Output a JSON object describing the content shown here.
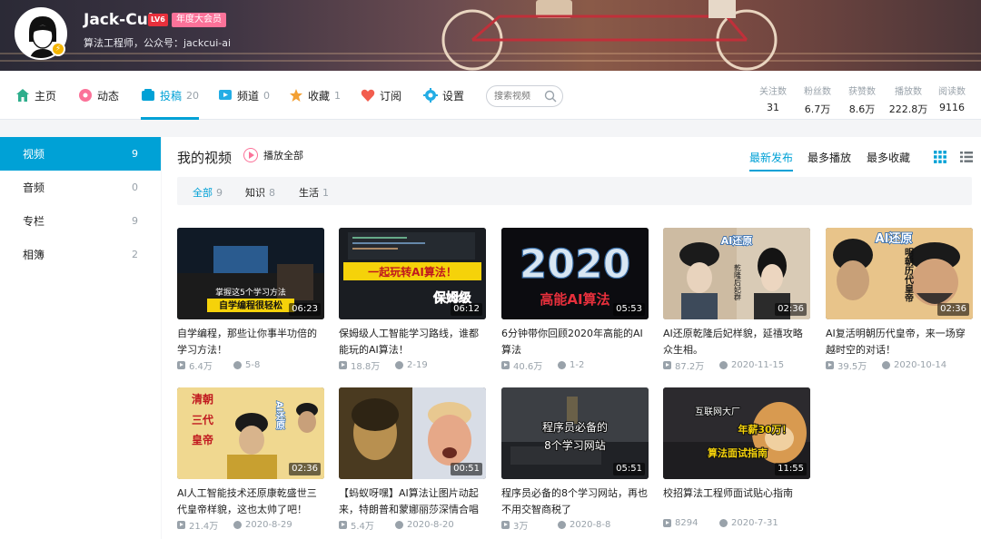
{
  "user": {
    "name": "Jack-Cui",
    "level": "LV6",
    "vip_label": "年度大会员",
    "sign": "算法工程师，公众号：jackcui-ai"
  },
  "nav": {
    "items": [
      {
        "label": "主页",
        "count": "",
        "icon": "home-icon",
        "color": "#23ade5"
      },
      {
        "label": "动态",
        "count": "",
        "icon": "dynamic-icon",
        "color": "#fb7299"
      },
      {
        "label": "投稿",
        "count": "20",
        "icon": "upload-icon",
        "color": "#00a1d6"
      },
      {
        "label": "频道",
        "count": "0",
        "icon": "channel-icon",
        "color": "#23ade5"
      },
      {
        "label": "收藏",
        "count": "1",
        "icon": "star-icon",
        "color": "#f3a034"
      },
      {
        "label": "订阅",
        "count": "",
        "icon": "heart-icon",
        "color": "#f25d4e"
      },
      {
        "label": "设置",
        "count": "",
        "icon": "gear-icon",
        "color": "#23ade5"
      }
    ],
    "search_placeholder": "搜索视频"
  },
  "stats": [
    {
      "label": "关注数",
      "value": "31"
    },
    {
      "label": "粉丝数",
      "value": "6.7万"
    },
    {
      "label": "获赞数",
      "value": "8.6万"
    },
    {
      "label": "播放数",
      "value": "222.8万"
    },
    {
      "label": "阅读数",
      "value": "9116"
    }
  ],
  "sidebar": {
    "items": [
      {
        "label": "视频",
        "count": "9"
      },
      {
        "label": "音频",
        "count": "0"
      },
      {
        "label": "专栏",
        "count": "9"
      },
      {
        "label": "相簿",
        "count": "2"
      }
    ]
  },
  "main": {
    "title": "我的视频",
    "play_all": "播放全部",
    "sort": [
      "最新发布",
      "最多播放",
      "最多收藏"
    ],
    "filters": [
      {
        "label": "全部",
        "count": "9"
      },
      {
        "label": "知识",
        "count": "8"
      },
      {
        "label": "生活",
        "count": "1"
      }
    ]
  },
  "videos": [
    {
      "title": "自学编程，那些让你事半功倍的学习方法！",
      "duration": "06:23",
      "plays": "6.4万",
      "date": "5-8",
      "thumb_text": [
        "掌握这5个学习方法",
        "自学编程很轻松"
      ]
    },
    {
      "title": "保姆级人工智能学习路线，谁都能玩的AI算法！",
      "duration": "06:12",
      "plays": "18.8万",
      "date": "2-19",
      "thumb_text": [
        "一起玩转AI算法！",
        "保姆级"
      ]
    },
    {
      "title": "6分钟带你回顾2020年高能的AI算法",
      "duration": "05:53",
      "plays": "40.6万",
      "date": "1-2",
      "thumb_text": [
        "2020",
        "高能AI算法"
      ]
    },
    {
      "title": "AI还原乾隆后妃样貌，延禧攻略众生相。",
      "duration": "02:36",
      "plays": "87.2万",
      "date": "2020-11-15",
      "thumb_text": [
        "AI还原",
        "乾隆后妃群"
      ]
    },
    {
      "title": "AI复活明朝历代皇帝，来一场穿越时空的对话！",
      "duration": "02:36",
      "plays": "39.5万",
      "date": "2020-10-14",
      "thumb_text": [
        "AI还原",
        "明朝历代皇帝"
      ]
    },
    {
      "title": "AI人工智能技术还原康乾盛世三代皇帝样貌，这也太帅了吧！",
      "duration": "02:36",
      "plays": "21.4万",
      "date": "2020-8-29",
      "thumb_text": [
        "清朝",
        "三代",
        "皇帝",
        "AI还原"
      ]
    },
    {
      "title": "【蚂蚁呀嘿】AI算法让图片动起来，特朗普和蒙娜丽莎深情合唱",
      "duration": "00:51",
      "plays": "5.4万",
      "date": "2020-8-20",
      "thumb_text": []
    },
    {
      "title": "程序员必备的8个学习网站，再也不用交智商税了",
      "duration": "05:51",
      "plays": "3万",
      "date": "2020-8-8",
      "thumb_text": [
        "程序员必备的",
        "8个学习网站"
      ]
    },
    {
      "title": "校招算法工程师面试贴心指南",
      "duration": "11:55",
      "plays": "8294",
      "date": "2020-7-31",
      "thumb_text": [
        "互联网大厂",
        "年薪30万！",
        "算法面试指南"
      ]
    }
  ]
}
